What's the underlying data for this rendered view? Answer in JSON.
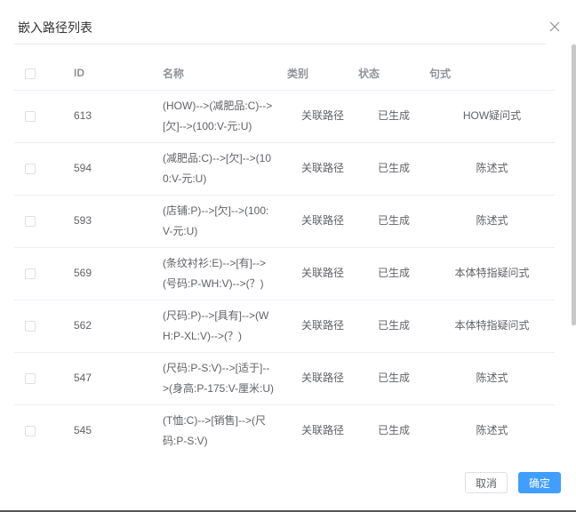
{
  "dialog": {
    "title": "嵌入路径列表",
    "cancel_label": "取消",
    "ok_label": "确定",
    "accent": "#409eff"
  },
  "table": {
    "headers": {
      "id": "ID",
      "name": "名称",
      "category": "类别",
      "status": "状态",
      "pattern": "句式"
    },
    "rows": [
      {
        "id": "613",
        "name": "(HOW)-->(减肥品:C)-->[欠]-->(100:V-元:U)",
        "category": "关联路径",
        "status": "已生成",
        "pattern": "HOW疑问式"
      },
      {
        "id": "594",
        "name": "(减肥品:C)-->[欠]-->(100:V-元:U)",
        "category": "关联路径",
        "status": "已生成",
        "pattern": "陈述式"
      },
      {
        "id": "593",
        "name": "(店铺:P)-->[欠]-->(100:V-元:U)",
        "category": "关联路径",
        "status": "已生成",
        "pattern": "陈述式"
      },
      {
        "id": "569",
        "name": "(条纹衬衫:E)-->[有]-->(号码:P-WH:V)-->(？)",
        "category": "关联路径",
        "status": "已生成",
        "pattern": "本体特指疑问式"
      },
      {
        "id": "562",
        "name": "(尺码:P)-->[具有]-->(WH:P-XL:V)-->(？)",
        "category": "关联路径",
        "status": "已生成",
        "pattern": "本体特指疑问式"
      },
      {
        "id": "547",
        "name": "(尺码:P-S:V)-->[适于]-->(身高:P-175:V-厘米:U)",
        "category": "关联路径",
        "status": "已生成",
        "pattern": "陈述式"
      },
      {
        "id": "545",
        "name": "(T恤:C)-->[销售]-->(尺码:P-S:V)",
        "category": "关联路径",
        "status": "已生成",
        "pattern": "陈述式"
      }
    ]
  }
}
